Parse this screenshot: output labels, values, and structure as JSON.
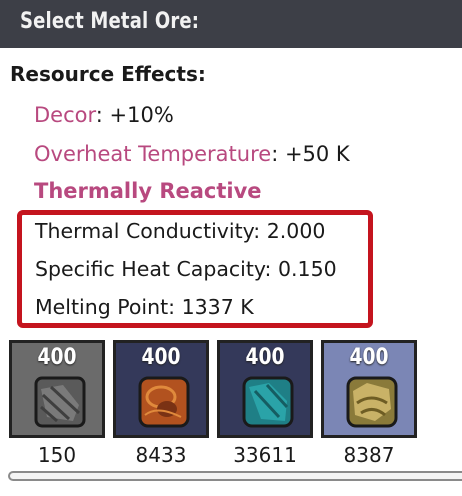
{
  "header": {
    "title": "Select Metal Ore:"
  },
  "resource_effects": {
    "title": "Resource Effects:",
    "decor": {
      "label": "Decor",
      "value": ": +10%"
    },
    "overheat": {
      "label": "Overheat Temperature",
      "value": ": +50 K"
    },
    "reactive": "Thermally Reactive"
  },
  "properties": {
    "thermal_conductivity": "Thermal Conductivity: 2.000",
    "specific_heat": "Specific Heat Capacity: 0.150",
    "melting_point": "Melting Point: 1337 K"
  },
  "ores": [
    {
      "amount": "400",
      "count": "150",
      "bg": "#6b6b6b",
      "icon": "raw-metal-ore-icon"
    },
    {
      "amount": "400",
      "count": "8433",
      "bg": "#34395a",
      "icon": "copper-ore-icon"
    },
    {
      "amount": "400",
      "count": "33611",
      "bg": "#34395a",
      "icon": "aluminum-ore-icon"
    },
    {
      "amount": "400",
      "count": "8387",
      "bg": "#7b86b5",
      "icon": "gold-amalgam-icon"
    }
  ],
  "colors": {
    "accent_pink": "#b8497f",
    "highlight_red": "#c4141e",
    "header_bg": "#3d3f47"
  }
}
